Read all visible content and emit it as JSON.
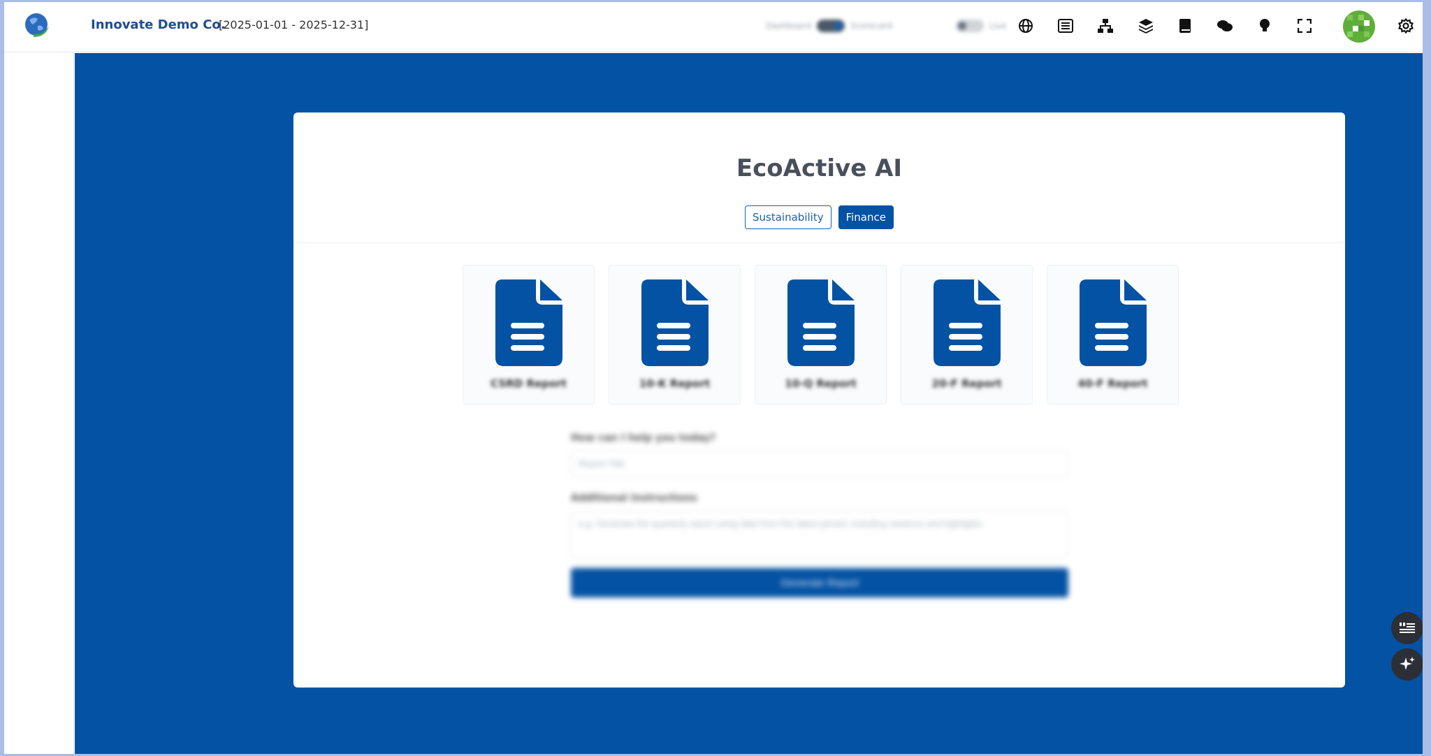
{
  "header": {
    "company_name": "Innovate Demo Co.",
    "date_range": "[2025-01-01 - 2025-12-31]",
    "toggle_left_label": "Dashboard",
    "toggle_mid_label": "Scorecard",
    "toggle_right_label": "Live",
    "icons": [
      "globe-icon",
      "list-icon",
      "sitemap-icon",
      "layers-icon",
      "book-icon",
      "chat-icon",
      "lightbulb-icon",
      "fullscreen-icon",
      "avatar",
      "gear-icon"
    ]
  },
  "card": {
    "title": "EcoActive AI",
    "tabs": [
      {
        "label": "Sustainability",
        "active": false
      },
      {
        "label": "Finance",
        "active": true
      }
    ],
    "reports": [
      {
        "label": "CSRD Report"
      },
      {
        "label": "10-K Report"
      },
      {
        "label": "10-Q Report"
      },
      {
        "label": "20-F Report"
      },
      {
        "label": "40-F Report"
      }
    ],
    "form": {
      "question_label": "How can I help you today?",
      "input_placeholder": "Report Title",
      "instructions_label": "Additional Instructions",
      "textarea_placeholder": "e.g. Generate the quarterly report using data from the latest period, including variance and highlights",
      "submit_label": "Generate Report"
    }
  },
  "colors": {
    "brand_blue": "#0452a3",
    "company_text": "#1f4e93",
    "title_text": "#4a4f5c"
  }
}
